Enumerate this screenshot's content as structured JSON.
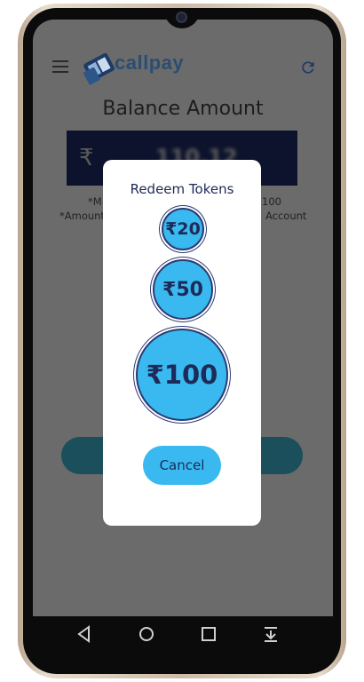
{
  "app": {
    "name": "callpay",
    "logo_text": "callpay"
  },
  "header": {
    "menu_icon": "hamburger-menu-icon",
    "refresh_icon": "refresh-icon"
  },
  "balance": {
    "title": "Balance Amount",
    "currency_symbol": "₹",
    "value": "110.12",
    "note_left_1": "*M",
    "note_right_1": "100",
    "note_left_2": "*Amount",
    "note_right_2": "Account"
  },
  "dialog": {
    "title": "Redeem Tokens",
    "tokens": [
      {
        "label": "₹20"
      },
      {
        "label": "₹50"
      },
      {
        "label": "₹100"
      }
    ],
    "cancel_label": "Cancel"
  },
  "navbar": {
    "icons": [
      "back-icon",
      "home-icon",
      "recents-icon",
      "notifications-down-icon"
    ]
  },
  "colors": {
    "accent": "#39b9ef",
    "dialog_text": "#1e2a57",
    "overlay": "#6b6b6b",
    "balance_box": "#0d132c"
  }
}
